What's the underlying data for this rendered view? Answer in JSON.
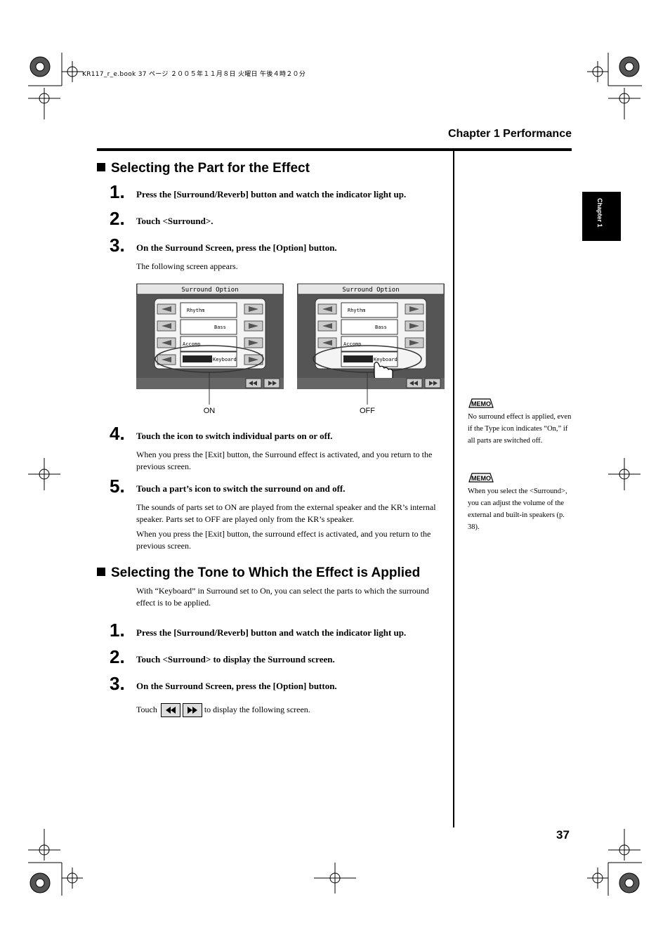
{
  "print_header": "KR117_r_e.book  37 ページ  ２００５年１１月８日  火曜日  午後４時２０分",
  "chapter_heading": "Chapter 1 Performance",
  "side_tab": "Chapter 1",
  "section1": {
    "title": "Selecting the Part for the Effect",
    "steps": [
      {
        "num": "1.",
        "text": "Press the [Surround/Reverb] button and watch the indicator light up."
      },
      {
        "num": "2.",
        "text": "Touch <Surround>."
      },
      {
        "num": "3.",
        "text": "On the Surround Screen, press the [Option] button."
      },
      {
        "num": "4.",
        "text": "Touch the icon to switch individual parts on or off."
      },
      {
        "num": "5.",
        "text": "Touch a part’s icon to switch the surround on and off."
      }
    ],
    "following_screen": "The following screen appears.",
    "step4_note": "When you press the [Exit] button, the Surround effect is activated, and you return to the previous screen.",
    "step5_note1": "The sounds of parts set to ON are played from the external speaker and the KR’s internal speaker. Parts set to OFF are played only from the KR’s speaker.",
    "step5_note2": "When you press the [Exit] button, the surround effect is activated, and you return to the previous screen."
  },
  "screens": {
    "title": "Surround Option",
    "parts": [
      "Rhythm",
      "Bass",
      "Accomp",
      "Keyboard"
    ],
    "label_on": "ON",
    "label_off": "OFF"
  },
  "section2": {
    "title": "Selecting the Tone to Which the Effect is Applied",
    "intro": "With “Keyboard” in Surround set to On, you can select the parts to which the surround effect is to be applied.",
    "steps": [
      {
        "num": "1.",
        "text": "Press the [Surround/Reverb] button and watch the indicator light up."
      },
      {
        "num": "2.",
        "text": "Touch <Surround> to display the Surround screen."
      },
      {
        "num": "3.",
        "text": "On the Surround Screen, press the [Option] button."
      }
    ],
    "touch_prefix": "Touch",
    "touch_suffix": "to display the following screen."
  },
  "memos": [
    {
      "label": "MEMO",
      "text": "No surround effect is applied, even if the Type icon indicates “On,” if all parts are switched off."
    },
    {
      "label": "MEMO",
      "text": "When you select the <Surround>, you can adjust the volume of the external and built-in speakers (p. 38)."
    }
  ],
  "page_number": "37"
}
